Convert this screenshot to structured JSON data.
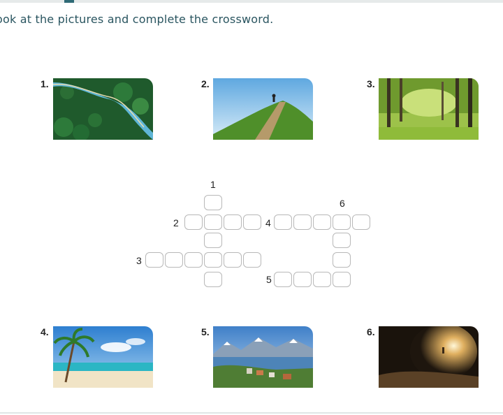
{
  "instruction": "ook at the pictures and complete the crossword.",
  "pictures": [
    {
      "label": "1.",
      "icon": "river-forest-aerial"
    },
    {
      "label": "2.",
      "icon": "hill-runner"
    },
    {
      "label": "3.",
      "icon": "forest"
    },
    {
      "label": "4.",
      "icon": "beach-palm"
    },
    {
      "label": "5.",
      "icon": "lake-mountains-town"
    },
    {
      "label": "6.",
      "icon": "cave"
    }
  ],
  "crossword": {
    "clue_numbers": [
      "1",
      "2",
      "3",
      "4",
      "5",
      "6"
    ]
  }
}
